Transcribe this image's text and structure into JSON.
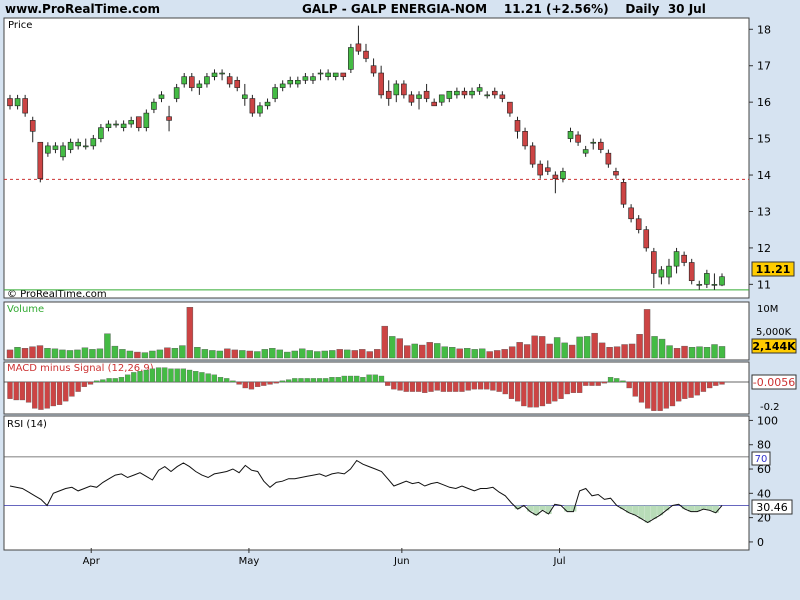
{
  "header": {
    "source": "www.ProRealTime.com",
    "title": "GALP - GALP ENERGIA-NOM",
    "last": "11.21 (+2.56%)",
    "period": "Daily",
    "date": "30 Jul"
  },
  "panels": {
    "price": {
      "label": "Price",
      "watermark": "© ProRealTime.com",
      "last_label": "11.21"
    },
    "volume": {
      "label": "Volume",
      "last_label": "2,144K"
    },
    "macd": {
      "label": "MACD minus Signal (12,26,9)",
      "last_label": "-0.0056"
    },
    "rsi": {
      "label": "RSI (14)",
      "last_label": "30.46",
      "overbought_label": "70"
    }
  },
  "chart_data": [
    {
      "type": "candlestick",
      "title": "Price",
      "x_ticks": [
        "Apr",
        "May",
        "Jun",
        "Jul"
      ],
      "y_ticks": [
        11,
        12,
        13,
        14,
        15,
        16,
        17,
        18
      ],
      "ylim": [
        10.9,
        18.2
      ],
      "reference_lines": [
        13.88,
        10.85
      ],
      "colors": {
        "up": "#44bb44",
        "down": "#cc4444",
        "dashed_line": "#cc3333",
        "support_line": "#33aa33"
      },
      "ohlc": [
        [
          16.1,
          16.2,
          15.8,
          15.9
        ],
        [
          15.9,
          16.2,
          15.8,
          16.1
        ],
        [
          16.1,
          16.2,
          15.6,
          15.7
        ],
        [
          15.5,
          15.6,
          14.9,
          15.2
        ],
        [
          14.9,
          14.9,
          13.8,
          13.9
        ],
        [
          14.6,
          14.9,
          14.5,
          14.8
        ],
        [
          14.7,
          14.9,
          14.6,
          14.8
        ],
        [
          14.5,
          14.9,
          14.4,
          14.8
        ],
        [
          14.7,
          15.0,
          14.6,
          14.9
        ],
        [
          14.8,
          15.0,
          14.7,
          14.9
        ],
        [
          14.8,
          15.0,
          14.7,
          14.8
        ],
        [
          14.8,
          15.1,
          14.7,
          15.0
        ],
        [
          15.0,
          15.4,
          14.9,
          15.3
        ],
        [
          15.3,
          15.5,
          15.2,
          15.4
        ],
        [
          15.4,
          15.5,
          15.3,
          15.4
        ],
        [
          15.3,
          15.5,
          15.2,
          15.4
        ],
        [
          15.4,
          15.6,
          15.3,
          15.5
        ],
        [
          15.6,
          15.6,
          15.2,
          15.3
        ],
        [
          15.3,
          15.8,
          15.2,
          15.7
        ],
        [
          15.8,
          16.1,
          15.7,
          16.0
        ],
        [
          16.1,
          16.3,
          16.0,
          16.2
        ],
        [
          15.6,
          15.9,
          15.2,
          15.5
        ],
        [
          16.1,
          16.5,
          16.0,
          16.4
        ],
        [
          16.5,
          16.8,
          16.4,
          16.7
        ],
        [
          16.7,
          16.8,
          16.3,
          16.4
        ],
        [
          16.4,
          16.6,
          16.2,
          16.5
        ],
        [
          16.5,
          16.8,
          16.4,
          16.7
        ],
        [
          16.7,
          16.9,
          16.6,
          16.8
        ],
        [
          16.8,
          16.9,
          16.6,
          16.8
        ],
        [
          16.7,
          16.8,
          16.4,
          16.5
        ],
        [
          16.6,
          16.7,
          16.3,
          16.4
        ],
        [
          16.1,
          16.5,
          15.9,
          16.2
        ],
        [
          16.1,
          16.2,
          15.6,
          15.7
        ],
        [
          15.7,
          16.0,
          15.6,
          15.9
        ],
        [
          15.9,
          16.1,
          15.8,
          16.0
        ],
        [
          16.1,
          16.5,
          16.0,
          16.4
        ],
        [
          16.4,
          16.6,
          16.3,
          16.5
        ],
        [
          16.5,
          16.7,
          16.4,
          16.6
        ],
        [
          16.5,
          16.7,
          16.4,
          16.6
        ],
        [
          16.6,
          16.8,
          16.5,
          16.7
        ],
        [
          16.6,
          16.8,
          16.5,
          16.7
        ],
        [
          16.8,
          16.9,
          16.6,
          16.8
        ],
        [
          16.7,
          16.9,
          16.6,
          16.8
        ],
        [
          16.7,
          16.8,
          16.6,
          16.8
        ],
        [
          16.8,
          16.8,
          16.6,
          16.7
        ],
        [
          16.9,
          17.6,
          16.8,
          17.5
        ],
        [
          17.6,
          18.1,
          17.3,
          17.4
        ],
        [
          17.4,
          17.6,
          17.1,
          17.2
        ],
        [
          17.0,
          17.2,
          16.7,
          16.8
        ],
        [
          16.8,
          17.0,
          16.1,
          16.2
        ],
        [
          16.3,
          16.6,
          15.9,
          16.1
        ],
        [
          16.2,
          16.6,
          16.0,
          16.5
        ],
        [
          16.5,
          16.6,
          16.1,
          16.2
        ],
        [
          16.2,
          16.3,
          15.9,
          16.0
        ],
        [
          16.1,
          16.3,
          15.8,
          16.2
        ],
        [
          16.3,
          16.5,
          16.0,
          16.1
        ],
        [
          16.0,
          16.1,
          15.9,
          15.9
        ],
        [
          16.0,
          16.2,
          15.9,
          16.2
        ],
        [
          16.1,
          16.3,
          16.0,
          16.3
        ],
        [
          16.2,
          16.4,
          16.1,
          16.3
        ],
        [
          16.3,
          16.4,
          16.1,
          16.2
        ],
        [
          16.2,
          16.4,
          16.1,
          16.3
        ],
        [
          16.3,
          16.5,
          16.2,
          16.4
        ],
        [
          16.2,
          16.3,
          16.1,
          16.2
        ],
        [
          16.3,
          16.4,
          16.1,
          16.2
        ],
        [
          16.2,
          16.3,
          16.0,
          16.1
        ],
        [
          16.0,
          16.0,
          15.6,
          15.7
        ],
        [
          15.5,
          15.6,
          15.0,
          15.2
        ],
        [
          15.2,
          15.3,
          14.7,
          14.8
        ],
        [
          14.8,
          14.9,
          14.2,
          14.3
        ],
        [
          14.3,
          14.4,
          13.9,
          14.0
        ],
        [
          14.2,
          14.4,
          14.0,
          14.1
        ],
        [
          14.0,
          14.1,
          13.5,
          13.9
        ],
        [
          13.9,
          14.2,
          13.8,
          14.1
        ],
        [
          15.0,
          15.3,
          14.9,
          15.2
        ],
        [
          15.1,
          15.2,
          14.8,
          14.9
        ],
        [
          14.6,
          14.8,
          14.5,
          14.7
        ],
        [
          14.9,
          15.0,
          14.7,
          14.9
        ],
        [
          14.9,
          15.0,
          14.6,
          14.7
        ],
        [
          14.6,
          14.7,
          14.2,
          14.3
        ],
        [
          14.1,
          14.2,
          13.9,
          14.0
        ],
        [
          13.8,
          13.9,
          13.1,
          13.2
        ],
        [
          13.1,
          13.2,
          12.7,
          12.8
        ],
        [
          12.8,
          12.9,
          12.4,
          12.5
        ],
        [
          12.5,
          12.6,
          11.9,
          12.0
        ],
        [
          11.9,
          12.0,
          10.9,
          11.3
        ],
        [
          11.2,
          11.5,
          11.0,
          11.4
        ],
        [
          11.2,
          11.7,
          11.0,
          11.5
        ],
        [
          11.5,
          12.0,
          11.3,
          11.9
        ],
        [
          11.8,
          11.9,
          11.5,
          11.6
        ],
        [
          11.6,
          11.7,
          11.0,
          11.1
        ],
        [
          11.0,
          11.1,
          10.85,
          11.0
        ],
        [
          11.0,
          11.4,
          10.9,
          11.3
        ],
        [
          11.0,
          11.3,
          10.85,
          11.0
        ],
        [
          10.98,
          11.3,
          10.95,
          11.21
        ]
      ]
    },
    {
      "type": "bar",
      "title": "Volume",
      "y_ticks": [
        "10M",
        "5,000K"
      ],
      "colors": {
        "up": "#44bb44",
        "down": "#cc4444"
      },
      "values_k": [
        1500,
        2000,
        1800,
        2100,
        2300,
        1800,
        1700,
        1500,
        1400,
        1500,
        1900,
        1600,
        1700,
        4500,
        2200,
        1600,
        1300,
        1100,
        1000,
        1300,
        1500,
        1900,
        1800,
        2300,
        9400,
        2000,
        1600,
        1400,
        1300,
        1700,
        1500,
        1400,
        1300,
        1200,
        1600,
        1800,
        1500,
        1100,
        1300,
        1700,
        1400,
        1200,
        1300,
        1400,
        1600,
        1500,
        1400,
        1600,
        1200,
        1600,
        5900,
        4000,
        3600,
        2300,
        2600,
        2400,
        2900,
        2700,
        2100,
        2000,
        1700,
        1800,
        1600,
        1700,
        1200,
        1400,
        1600,
        2100,
        2900,
        2500,
        4100,
        4000,
        2600,
        3800,
        2800,
        2400,
        3900,
        4000,
        4600,
        2800,
        2000,
        2100,
        2500,
        2600,
        4400,
        9000,
        4000,
        3500,
        2300,
        1800,
        2200,
        2000,
        2100,
        2000,
        2500,
        2144
      ]
    },
    {
      "type": "bar",
      "title": "MACD minus Signal (12,26,9)",
      "y_ticks": [
        0,
        -0.2
      ],
      "ylim": [
        -0.25,
        0.15
      ],
      "colors": {
        "up": "#44bb44",
        "down": "#cc4444"
      },
      "values": [
        -0.14,
        -0.15,
        -0.15,
        -0.17,
        -0.22,
        -0.23,
        -0.22,
        -0.2,
        -0.19,
        -0.16,
        -0.12,
        -0.08,
        -0.04,
        -0.02,
        0.01,
        0.02,
        0.03,
        0.03,
        0.04,
        0.06,
        0.08,
        0.09,
        0.1,
        0.11,
        0.12,
        0.12,
        0.11,
        0.11,
        0.11,
        0.1,
        0.09,
        0.08,
        0.07,
        0.06,
        0.04,
        0.03,
        0.01,
        -0.02,
        -0.05,
        -0.06,
        -0.04,
        -0.03,
        -0.02,
        -0.01,
        0.01,
        0.02,
        0.03,
        0.03,
        0.03,
        0.03,
        0.03,
        0.03,
        0.04,
        0.04,
        0.05,
        0.05,
        0.05,
        0.04,
        0.06,
        0.06,
        0.05,
        -0.03,
        -0.06,
        -0.07,
        -0.08,
        -0.08,
        -0.08,
        -0.09,
        -0.08,
        -0.07,
        -0.08,
        -0.08,
        -0.08,
        -0.08,
        -0.07,
        -0.06,
        -0.06,
        -0.06,
        -0.07,
        -0.08,
        -0.1,
        -0.14,
        -0.16,
        -0.2,
        -0.21,
        -0.21,
        -0.2,
        -0.18,
        -0.16,
        -0.14,
        -0.1,
        -0.09,
        -0.09,
        -0.03,
        -0.03,
        -0.03,
        -0.01,
        0.04,
        0.03,
        0.01,
        -0.05,
        -0.12,
        -0.17,
        -0.22,
        -0.24,
        -0.24,
        -0.22,
        -0.2,
        -0.16,
        -0.14,
        -0.13,
        -0.11,
        -0.08,
        -0.05,
        -0.03,
        -0.02
      ]
    },
    {
      "type": "line",
      "title": "RSI (14)",
      "y_ticks": [
        0,
        20,
        40,
        60,
        70,
        80,
        100
      ],
      "ylim": [
        -5,
        102
      ],
      "reference_lines": [
        70,
        30
      ],
      "values": [
        46,
        45,
        44,
        41,
        38,
        35,
        30,
        40,
        42,
        44,
        45,
        42,
        44,
        46,
        45,
        49,
        52,
        55,
        56,
        53,
        55,
        57,
        54,
        51,
        59,
        62,
        58,
        62,
        65,
        62,
        58,
        55,
        53,
        56,
        57,
        58,
        60,
        57,
        63,
        59,
        58,
        50,
        45,
        49,
        50,
        52,
        52,
        53,
        54,
        55,
        56,
        54,
        56,
        57,
        56,
        60,
        67,
        64,
        62,
        60,
        58,
        52,
        46,
        48,
        50,
        48,
        49,
        46,
        48,
        49,
        47,
        45,
        44,
        46,
        44,
        42,
        44,
        44,
        45,
        41,
        38,
        32,
        27,
        30,
        25,
        22,
        26,
        23,
        31,
        30,
        25,
        25,
        42,
        44,
        38,
        39,
        35,
        36,
        30,
        27,
        24,
        22,
        19,
        16,
        19,
        22,
        26,
        30,
        31,
        27,
        25,
        25,
        27,
        26,
        24,
        30
      ]
    }
  ]
}
